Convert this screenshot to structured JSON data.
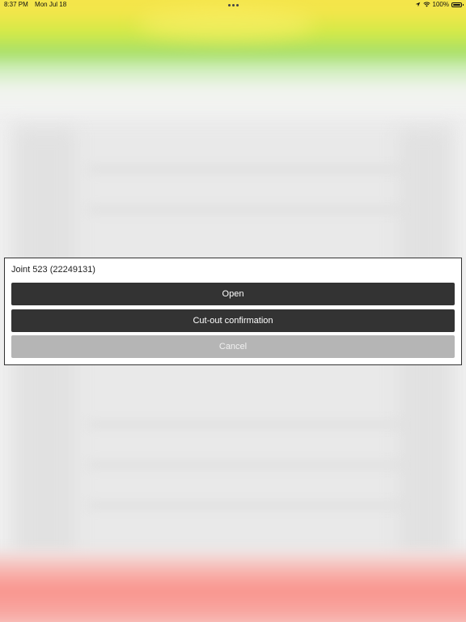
{
  "status_bar": {
    "time": "8:37 PM",
    "date": "Mon Jul 18",
    "battery": "100%",
    "battery_level": 1.0
  },
  "dialog": {
    "title": "Joint 523 (22249131)",
    "buttons": {
      "open": "Open",
      "cutout": "Cut-out confirmation",
      "cancel": "Cancel"
    }
  },
  "colors": {
    "primary_button": "#333333",
    "cancel_button": "#b5b5b5",
    "top_band": "#f3e64a",
    "bottom_band": "#f9948d"
  }
}
